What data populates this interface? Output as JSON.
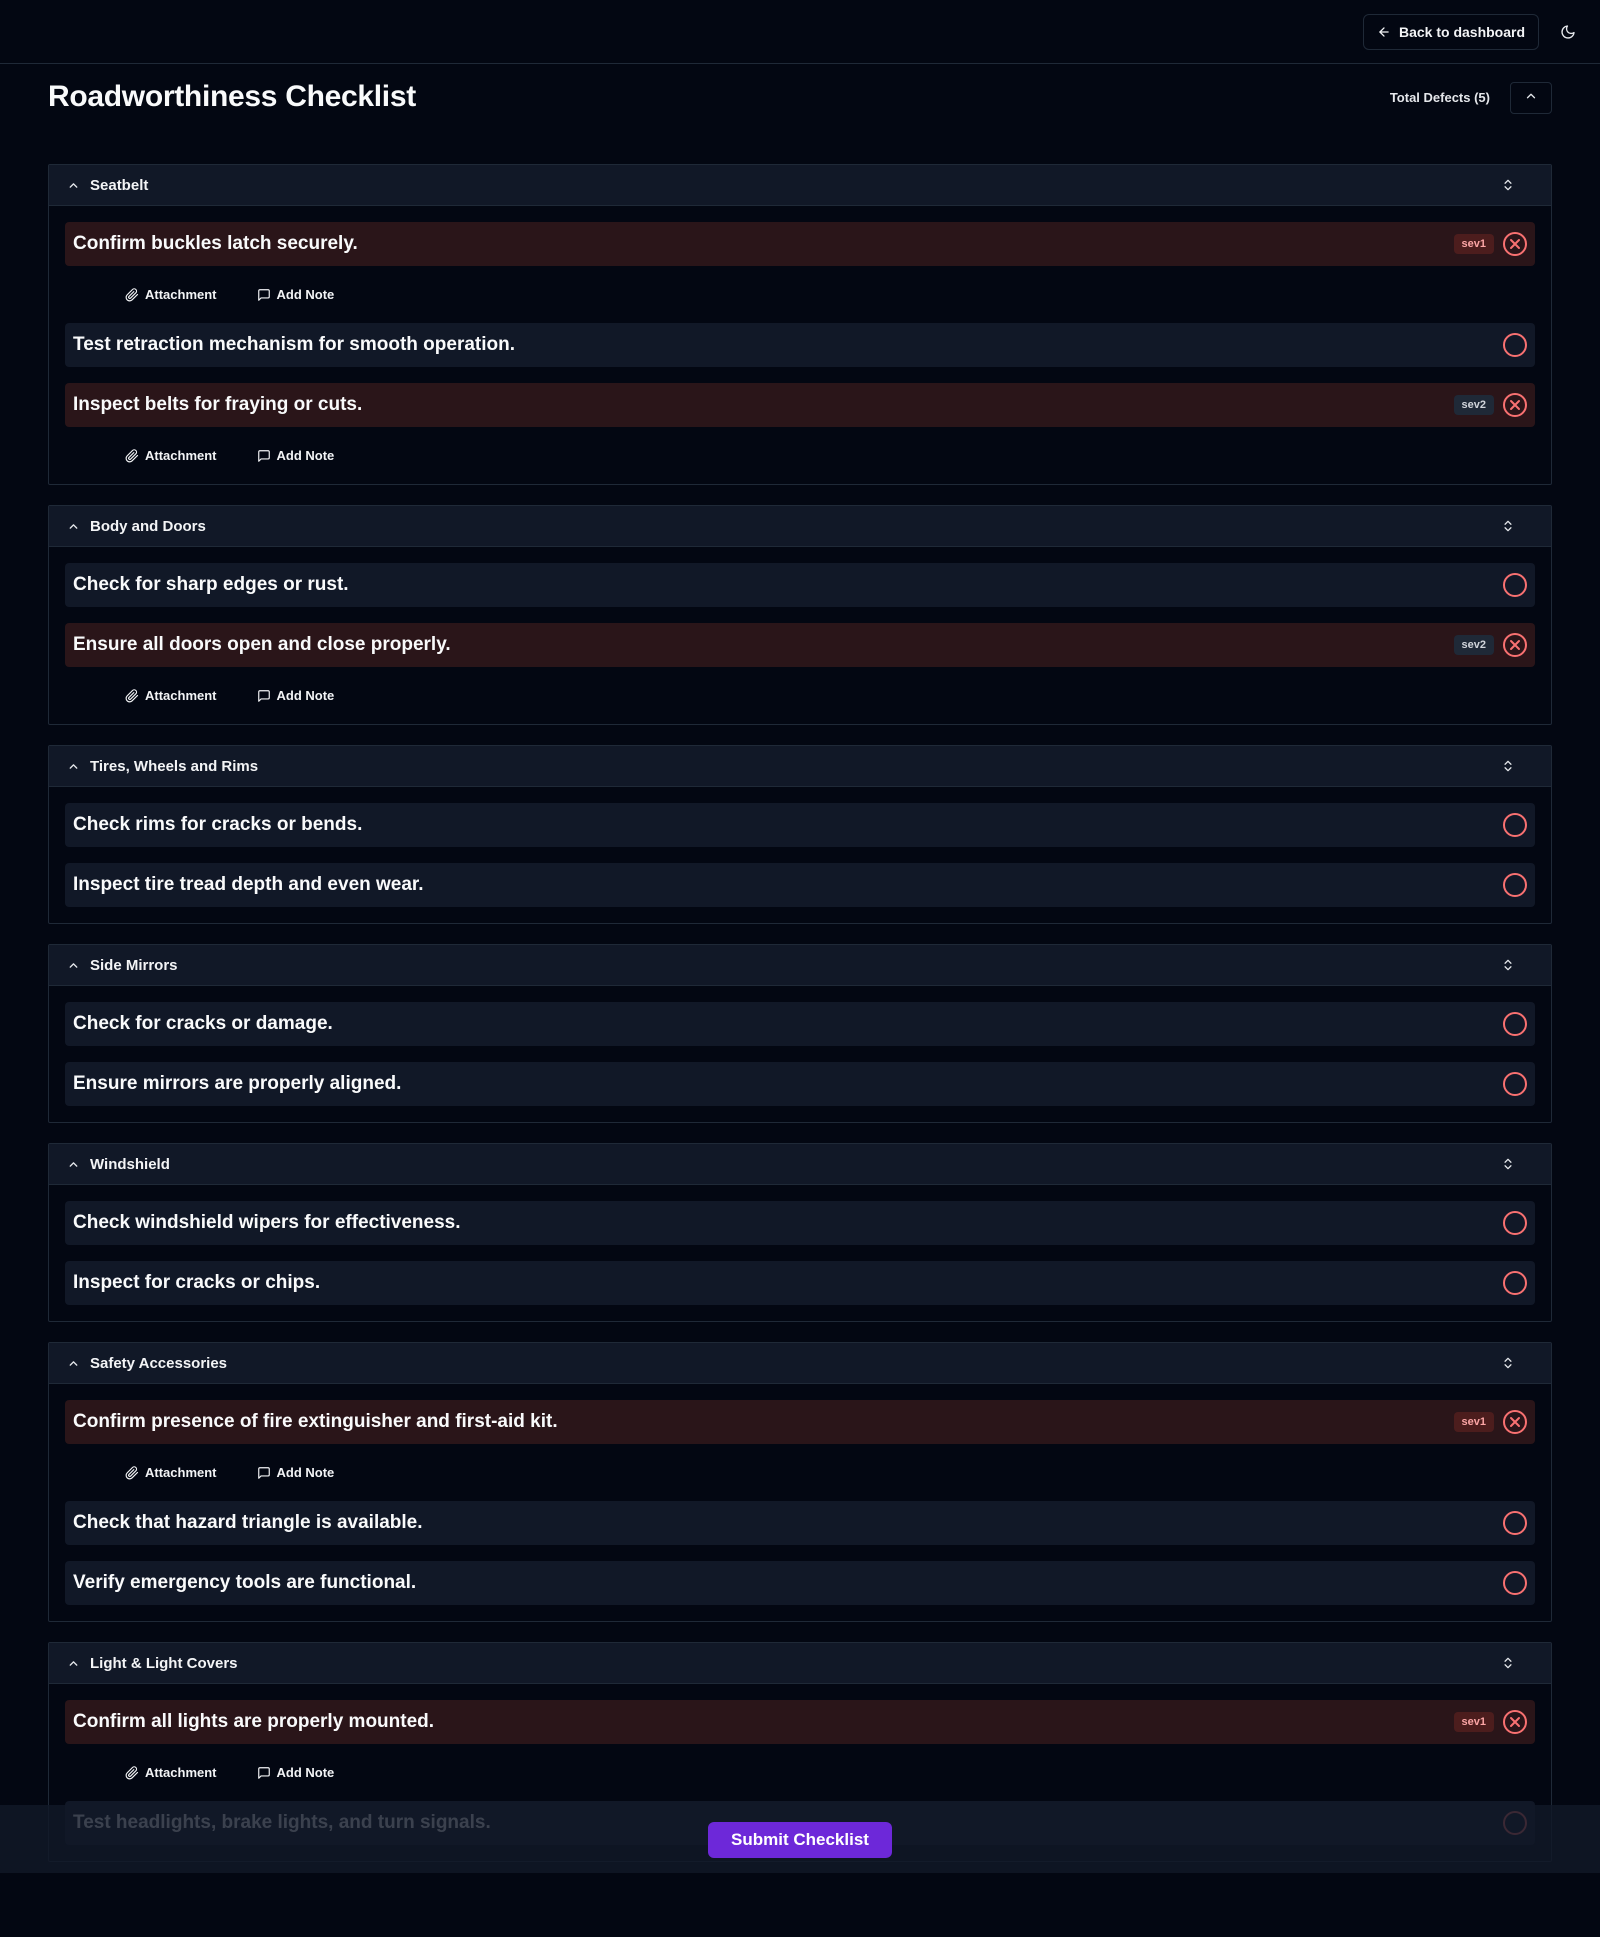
{
  "header": {
    "back_label": "Back to dashboard"
  },
  "page": {
    "title": "Roadworthiness Checklist",
    "total_defects_label": "Total Defects (5)"
  },
  "item_actions": {
    "attachment_label": "Attachment",
    "note_label": "Add Note"
  },
  "sections": [
    {
      "title": "Seatbelt",
      "items": [
        {
          "text": "Confirm buckles latch securely.",
          "defect": true,
          "severity": "sev1"
        },
        {
          "text": "Test retraction mechanism for smooth operation.",
          "defect": false,
          "severity": ""
        },
        {
          "text": "Inspect belts for fraying or cuts.",
          "defect": true,
          "severity": "sev2"
        }
      ]
    },
    {
      "title": "Body and Doors",
      "items": [
        {
          "text": "Check for sharp edges or rust.",
          "defect": false,
          "severity": ""
        },
        {
          "text": "Ensure all doors open and close properly.",
          "defect": true,
          "severity": "sev2"
        }
      ]
    },
    {
      "title": "Tires, Wheels and Rims",
      "items": [
        {
          "text": "Check rims for cracks or bends.",
          "defect": false,
          "severity": ""
        },
        {
          "text": "Inspect tire tread depth and even wear.",
          "defect": false,
          "severity": ""
        }
      ]
    },
    {
      "title": "Side Mirrors",
      "items": [
        {
          "text": "Check for cracks or damage.",
          "defect": false,
          "severity": ""
        },
        {
          "text": "Ensure mirrors are properly aligned.",
          "defect": false,
          "severity": ""
        }
      ]
    },
    {
      "title": "Windshield",
      "items": [
        {
          "text": "Check windshield wipers for effectiveness.",
          "defect": false,
          "severity": ""
        },
        {
          "text": "Inspect for cracks or chips.",
          "defect": false,
          "severity": ""
        }
      ]
    },
    {
      "title": "Safety Accessories",
      "items": [
        {
          "text": "Confirm presence of fire extinguisher and first-aid kit.",
          "defect": true,
          "severity": "sev1"
        },
        {
          "text": "Check that hazard triangle is available.",
          "defect": false,
          "severity": ""
        },
        {
          "text": "Verify emergency tools are functional.",
          "defect": false,
          "severity": ""
        }
      ]
    },
    {
      "title": "Light & Light Covers",
      "items": [
        {
          "text": "Confirm all lights are properly mounted.",
          "defect": true,
          "severity": "sev1"
        },
        {
          "text": "Test headlights, brake lights, and turn signals.",
          "defect": false,
          "severity": ""
        }
      ]
    }
  ],
  "footer": {
    "submit_label": "Submit Checklist"
  },
  "colors": {
    "background": "#030712",
    "panel": "#111827",
    "defect_row": "#2a1519",
    "status_red": "#f87171",
    "submit": "#6d28d9"
  }
}
